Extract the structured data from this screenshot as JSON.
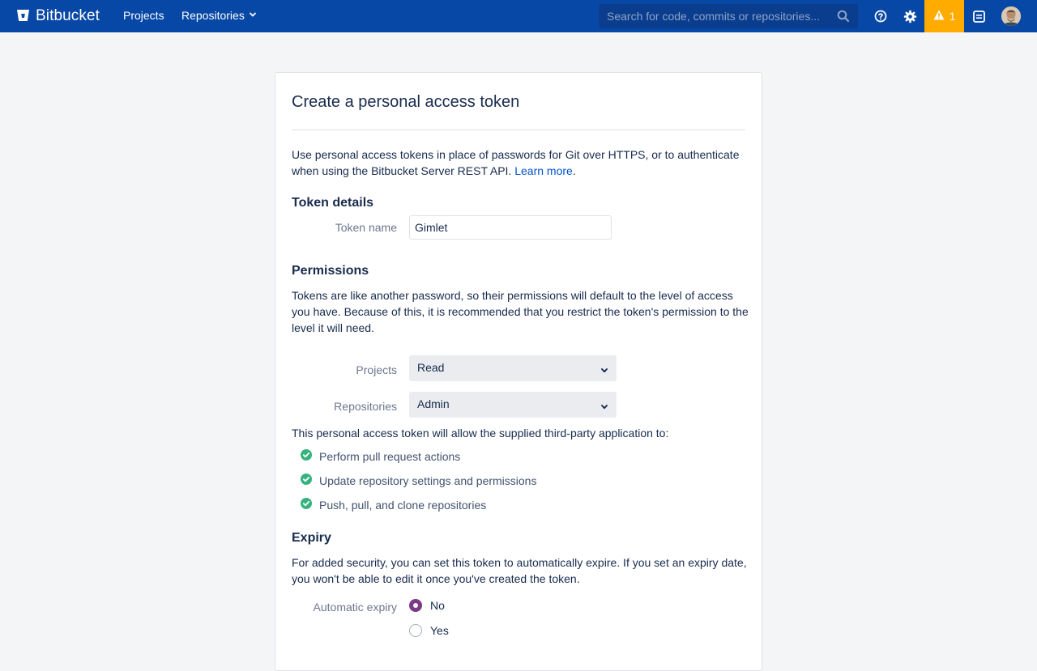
{
  "header": {
    "logo_text": "Bitbucket",
    "nav_projects": "Projects",
    "nav_repositories": "Repositories",
    "search_placeholder": "Search for code, commits or repositories...",
    "alert_count": "1",
    "icons": [
      "bitbucket-logo-icon",
      "chevron-down-icon",
      "search-icon",
      "help-icon",
      "gear-icon",
      "warning-icon",
      "inbox-icon",
      "avatar"
    ]
  },
  "page": {
    "title": "Create a personal access token",
    "intro_text": "Use personal access tokens in place of passwords for Git over HTTPS, or to authenticate when using the Bitbucket Server REST API.",
    "learn_more": "Learn more",
    "token_details_heading": "Token details",
    "token_name_label": "Token name",
    "token_name_value": "Gimlet",
    "permissions_heading": "Permissions",
    "permissions_text": "Tokens are like another password, so their permissions will default to the level of access you have. Because of this, it is recommended that you restrict the token's permission to the level it will need.",
    "projects_label": "Projects",
    "projects_value": "Read",
    "repositories_label": "Repositories",
    "repositories_value": "Admin",
    "allow_text": "This personal access token will allow the supplied third-party application to:",
    "allowed_actions": [
      "Perform pull request actions",
      "Update repository settings and permissions",
      "Push, pull, and clone repositories"
    ],
    "expiry_heading": "Expiry",
    "expiry_text": "For added security, you can set this token to automatically expire. If you set an expiry date, you won't be able to edit it once you've created the token.",
    "automatic_expiry_label": "Automatic expiry",
    "expiry_options": [
      "No",
      "Yes"
    ],
    "expiry_selected": "No"
  },
  "colors": {
    "nav_bg": "#0747a6",
    "alert_bg": "#ffab00",
    "link": "#0052cc",
    "check": "#36b37e",
    "radio_selected": "#7a3a86"
  }
}
